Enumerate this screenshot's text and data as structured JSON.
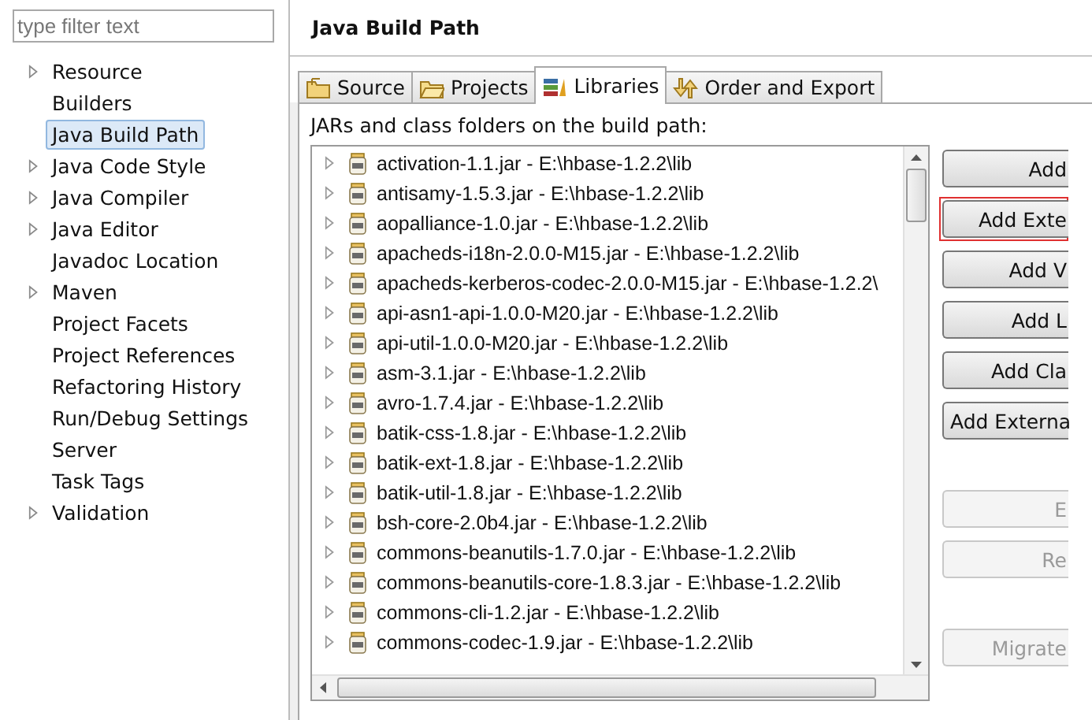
{
  "filter": {
    "placeholder": "type filter text"
  },
  "sidebar": {
    "items": [
      {
        "label": "Resource",
        "expandable": true,
        "selected": false
      },
      {
        "label": "Builders",
        "expandable": false,
        "selected": false
      },
      {
        "label": "Java Build Path",
        "expandable": false,
        "selected": true
      },
      {
        "label": "Java Code Style",
        "expandable": true,
        "selected": false
      },
      {
        "label": "Java Compiler",
        "expandable": true,
        "selected": false
      },
      {
        "label": "Java Editor",
        "expandable": true,
        "selected": false
      },
      {
        "label": "Javadoc Location",
        "expandable": false,
        "selected": false
      },
      {
        "label": "Maven",
        "expandable": true,
        "selected": false
      },
      {
        "label": "Project Facets",
        "expandable": false,
        "selected": false
      },
      {
        "label": "Project References",
        "expandable": false,
        "selected": false
      },
      {
        "label": "Refactoring History",
        "expandable": false,
        "selected": false
      },
      {
        "label": "Run/Debug Settings",
        "expandable": false,
        "selected": false
      },
      {
        "label": "Server",
        "expandable": false,
        "selected": false
      },
      {
        "label": "Task Tags",
        "expandable": false,
        "selected": false
      },
      {
        "label": "Validation",
        "expandable": true,
        "selected": false
      }
    ]
  },
  "page": {
    "title": "Java Build Path"
  },
  "tabs": [
    {
      "label": "Source",
      "kind": "source",
      "selected": false
    },
    {
      "label": "Projects",
      "kind": "projects",
      "selected": false
    },
    {
      "label": "Libraries",
      "kind": "libraries",
      "selected": true
    },
    {
      "label": "Order and Export",
      "kind": "order",
      "selected": false
    }
  ],
  "libraries": {
    "caption": "JARs and class folders on the build path:",
    "rows": [
      "activation-1.1.jar - E:\\hbase-1.2.2\\lib",
      "antisamy-1.5.3.jar - E:\\hbase-1.2.2\\lib",
      "aopalliance-1.0.jar - E:\\hbase-1.2.2\\lib",
      "apacheds-i18n-2.0.0-M15.jar - E:\\hbase-1.2.2\\lib",
      "apacheds-kerberos-codec-2.0.0-M15.jar - E:\\hbase-1.2.2\\",
      "api-asn1-api-1.0.0-M20.jar - E:\\hbase-1.2.2\\lib",
      "api-util-1.0.0-M20.jar - E:\\hbase-1.2.2\\lib",
      "asm-3.1.jar - E:\\hbase-1.2.2\\lib",
      "avro-1.7.4.jar - E:\\hbase-1.2.2\\lib",
      "batik-css-1.8.jar - E:\\hbase-1.2.2\\lib",
      "batik-ext-1.8.jar - E:\\hbase-1.2.2\\lib",
      "batik-util-1.8.jar - E:\\hbase-1.2.2\\lib",
      "bsh-core-2.0b4.jar - E:\\hbase-1.2.2\\lib",
      "commons-beanutils-1.7.0.jar - E:\\hbase-1.2.2\\lib",
      "commons-beanutils-core-1.8.3.jar - E:\\hbase-1.2.2\\lib",
      "commons-cli-1.2.jar - E:\\hbase-1.2.2\\lib",
      "commons-codec-1.9.jar - E:\\hbase-1.2.2\\lib"
    ]
  },
  "buttons": [
    {
      "label": "Add",
      "disabled": false,
      "highlighted": false
    },
    {
      "label": "Add Exte",
      "disabled": false,
      "highlighted": true
    },
    {
      "label": "Add V",
      "disabled": false,
      "highlighted": false
    },
    {
      "label": "Add L",
      "disabled": false,
      "highlighted": false
    },
    {
      "label": "Add Cla",
      "disabled": false,
      "highlighted": false
    },
    {
      "label": "Add Externa",
      "disabled": false,
      "highlighted": false
    },
    {
      "label": "E",
      "disabled": true,
      "highlighted": false
    },
    {
      "label": "Re",
      "disabled": true,
      "highlighted": false
    },
    {
      "label": "Migrate",
      "disabled": true,
      "highlighted": false
    }
  ]
}
